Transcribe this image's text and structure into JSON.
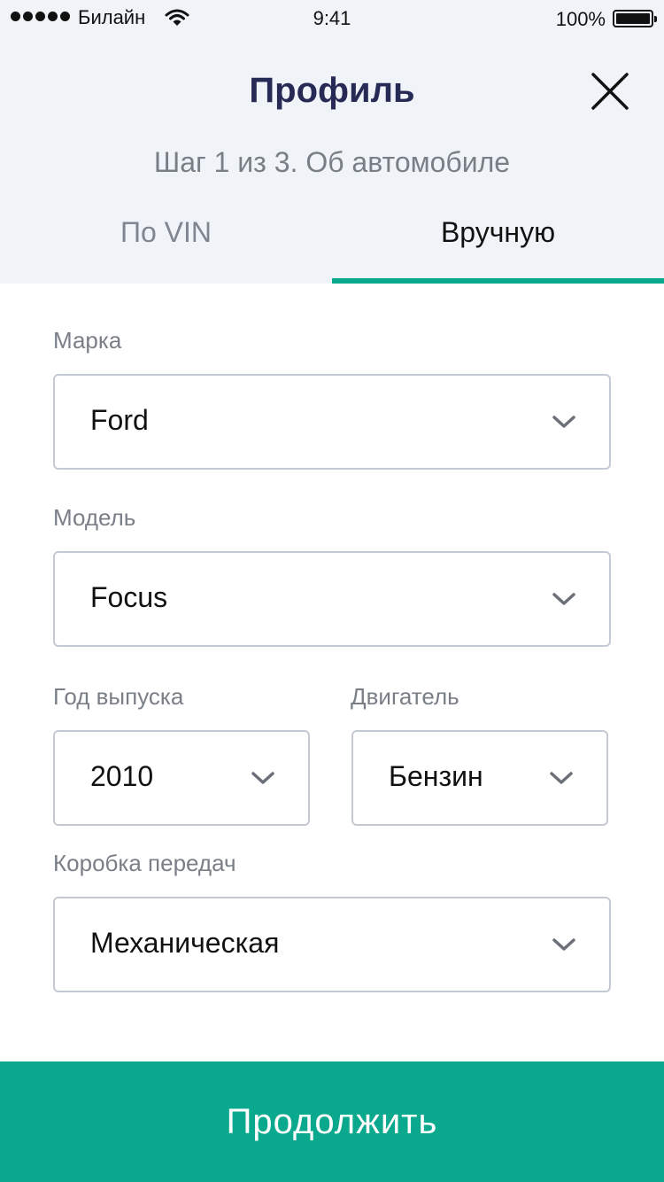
{
  "status_bar": {
    "carrier": "Билайн",
    "time": "9:41",
    "battery": "100%",
    "icons": [
      "signal-dots-icon",
      "wifi-icon",
      "battery-icon"
    ]
  },
  "header": {
    "title": "Профиль",
    "close_icon": "close-icon",
    "step": "Шаг 1 из 3. Об автомобиле"
  },
  "tabs": [
    {
      "label": "По VIN",
      "active": false
    },
    {
      "label": "Вручную",
      "active": true
    }
  ],
  "form": {
    "brand": {
      "label": "Марка",
      "value": "Ford"
    },
    "model": {
      "label": "Модель",
      "value": "Focus"
    },
    "year": {
      "label": "Год выпуска",
      "value": "2010"
    },
    "engine": {
      "label": "Двигатель",
      "value": "Бензин"
    },
    "gearbox": {
      "label": "Коробка передач",
      "value": "Механическая"
    }
  },
  "continue_label": "Продолжить",
  "colors": {
    "accent": "#0aa88c",
    "title": "#262a55",
    "header_bg": "#f0f4f9"
  }
}
